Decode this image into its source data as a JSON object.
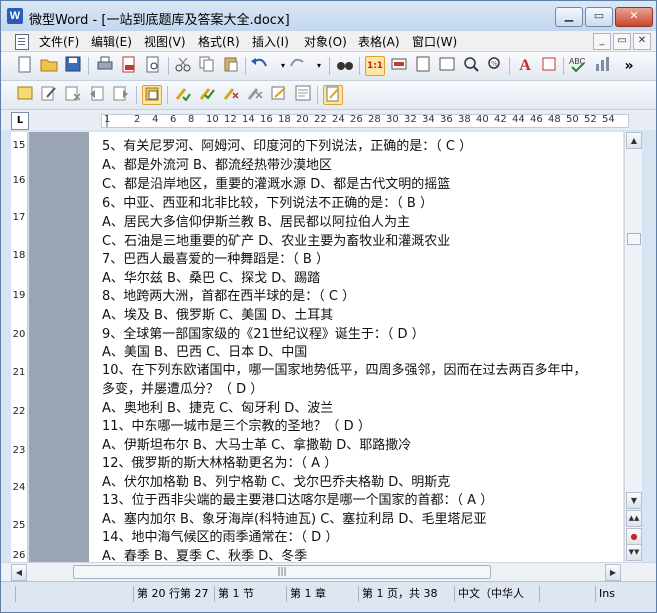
{
  "window": {
    "title": "微型Word - [一站到底题库及答案大全.docx]",
    "app_icon": "W",
    "buttons": {
      "minimize": "▁",
      "restore": "▭",
      "close": "✕"
    }
  },
  "menu": {
    "items": [
      "文件(F)",
      "编辑(E)",
      "视图(V)",
      "格式(R)",
      "插入(I)",
      "对象(O)",
      "表格(A)",
      "窗口(W)"
    ],
    "mdi": {
      "minimize": "_",
      "restore": "▭",
      "close": "✕"
    }
  },
  "toolbar_overflow": "»",
  "ruler": {
    "corner": "L",
    "numbers": [
      "1",
      "2",
      "4",
      "6",
      "8",
      "10",
      "12",
      "14",
      "16",
      "18",
      "20",
      "22",
      "24",
      "26",
      "28",
      "30",
      "32",
      "34",
      "36",
      "38",
      "40",
      "42",
      "44",
      "46",
      "48",
      "50",
      "52",
      "54"
    ],
    "vertical_numbers": [
      "15",
      "16",
      "17",
      "18",
      "19",
      "20",
      "21",
      "22",
      "23",
      "24",
      "25",
      "26"
    ]
  },
  "document": {
    "lines": [
      "5、有关尼罗河、阿姆河、印度河的下列说法，正确的是：（ C ）",
      "A、都是外流河 B、都流经热带沙漠地区",
      "C、都是沿岸地区，重要的灌溉水源 D、都是古代文明的摇篮",
      "6、中亚、西亚和北非比较，下列说法不正确的是：（ B ）",
      "A、居民大多信仰伊斯兰教 B、居民都以阿拉伯人为主",
      "C、石油是三地重要的矿产 D、农业主要为畜牧业和灌溉农业",
      "7、巴西人最喜爱的一种舞蹈是：（ B ）",
      "A、华尔兹 B、桑巴 C、探戈 D、踢踏",
      "8、地跨两大洲，首都在西半球的是：（ C ）",
      "A、埃及 B、俄罗斯 C、美国 D、土耳其",
      "9、全球第一部国家级的《21世纪议程》诞生于：（ D ）",
      "A、美国 B、巴西 C、日本 D、中国",
      "10、在下列东欧诸国中，哪一国家地势低平，四周多强邻，因而在过去两百多年中，",
      "多变，并屡遭瓜分？（ D ）",
      "A、奥地利 B、捷克 C、匈牙利 D、波兰",
      "11、中东哪一城市是三个宗教的圣地？（ D ）",
      "A、伊斯坦布尔 B、大马士革 C、拿撒勒 D、耶路撒冷",
      "12、俄罗斯的斯大林格勒更名为：（ A ）",
      "A、伏尔加格勒 B、列宁格勒 C、戈尔巴乔夫格勒 D、明斯克",
      "13、位于西非尖端的最主要港口达喀尔是哪一个国家的首都：（ A ）",
      "A、塞内加尔 B、象牙海岸(科特迪瓦) C、塞拉利昂 D、毛里塔尼亚",
      "14、地中海气候区的雨季通常在：（ D ）",
      "A、春季 B、夏季 C、秋季 D、冬季"
    ]
  },
  "scroll": {
    "hthumb_grip": "|||"
  },
  "status": {
    "position": "第 20 行第 27",
    "section": "第 1 节",
    "chapter": "第 1 章",
    "page": "第 1 页，共 38",
    "language": "中文（中华人",
    "mode": "Ins"
  }
}
